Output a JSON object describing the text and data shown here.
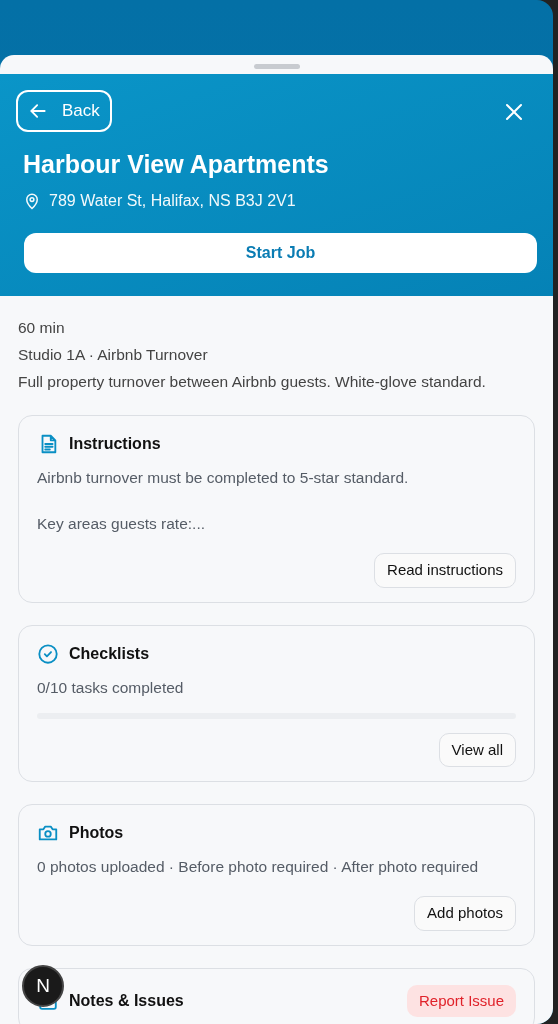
{
  "header": {
    "back_label": "Back",
    "title": "Harbour View Apartments",
    "address": "789 Water St, Halifax, NS B3J 2V1",
    "primary_action": "Start Job"
  },
  "summary": [
    "60 min",
    "Studio 1A · Airbnb Turnover",
    "Full property turnover between Airbnb guests. White-glove standard."
  ],
  "sections": [
    {
      "kind": "instructions",
      "title": "Instructions",
      "lines": [
        "Airbnb turnover must be completed to 5-star standard.",
        "Key areas guests rate:..."
      ],
      "action": "Read instructions"
    },
    {
      "kind": "checklist",
      "title": "Checklists",
      "lines": [
        "0/10 tasks completed"
      ],
      "level": 0,
      "action": "View all"
    },
    {
      "kind": "photos",
      "title": "Photos",
      "lines": [
        "0 photos uploaded · Before photo required · After photo required"
      ],
      "action": "Add photos"
    },
    {
      "kind": "notes",
      "title": "Notes & Issues",
      "danger_action": "Report Issue"
    }
  ],
  "dev_badge": "N"
}
